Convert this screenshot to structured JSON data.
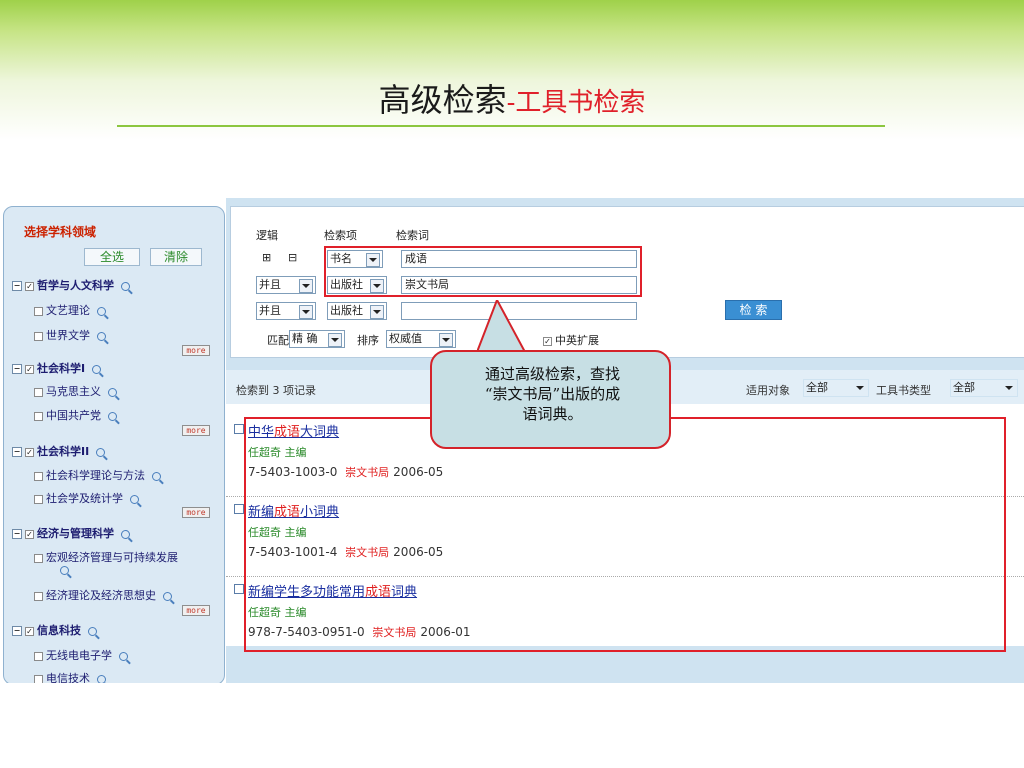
{
  "slide": {
    "title_main": "高级检索",
    "title_sep": "-",
    "title_sub": "工具书检索"
  },
  "sidebar": {
    "heading": "选择学科领域",
    "select_all": "全选",
    "clear": "清除",
    "more_label": "more",
    "categories": [
      {
        "label": "哲学与人文科学",
        "items": [
          "文艺理论",
          "世界文学"
        ]
      },
      {
        "label": "社会科学I",
        "items": [
          "马克思主义",
          "中国共产党"
        ]
      },
      {
        "label": "社会科学II",
        "items": [
          "社会科学理论与方法",
          "社会学及统计学"
        ]
      },
      {
        "label": "经济与管理科学",
        "items": [
          "宏观经济管理与可持续发展",
          "经济理论及经济思想史"
        ]
      },
      {
        "label": "信息科技",
        "items": [
          "无线电电子学",
          "电信技术"
        ]
      }
    ]
  },
  "form": {
    "col_logic": "逻辑",
    "col_field": "检索项",
    "col_term": "检索词",
    "rows": [
      {
        "logic": "",
        "field": "书名",
        "term": "成语"
      },
      {
        "logic": "并且",
        "field": "出版社",
        "term": "崇文书局"
      },
      {
        "logic": "并且",
        "field": "出版社",
        "term": ""
      }
    ],
    "match_label": "匹配",
    "match_value": "精 确",
    "sort_label": "排序",
    "sort_value": "权威值",
    "zh_en_label": "中英扩展",
    "search_button": "检 索"
  },
  "results": {
    "count_text": "检索到 3 项记录",
    "audience_label": "适用对象",
    "audience_value": "全部",
    "type_label": "工具书类型",
    "type_value": "全部",
    "items": [
      {
        "title_pre": "中华",
        "title_hl": "成语",
        "title_post": "大词典",
        "author": "任超奇 主编",
        "isbn": "7-5403-1003-0",
        "publisher": "崇文书局",
        "date": "2006-05"
      },
      {
        "title_pre": "新编",
        "title_hl": "成语",
        "title_post": "小词典",
        "author": "任超奇 主编",
        "isbn": "7-5403-1001-4",
        "publisher": "崇文书局",
        "date": "2006-05"
      },
      {
        "title_pre": "新编学生多功能常用",
        "title_hl": "成语",
        "title_post": "词典",
        "author": "任超奇 主编",
        "isbn": "978-7-5403-0951-0",
        "publisher": "崇文书局",
        "date": "2006-01"
      }
    ]
  },
  "callout": {
    "line1": "通过高级检索，查找",
    "line2": "“崇文书局”出版的成",
    "line3": "语词典。"
  },
  "colors": {
    "accent_green": "#8cc63f",
    "title_red": "#e0202a",
    "panel_blue": "#cfe3f1"
  }
}
